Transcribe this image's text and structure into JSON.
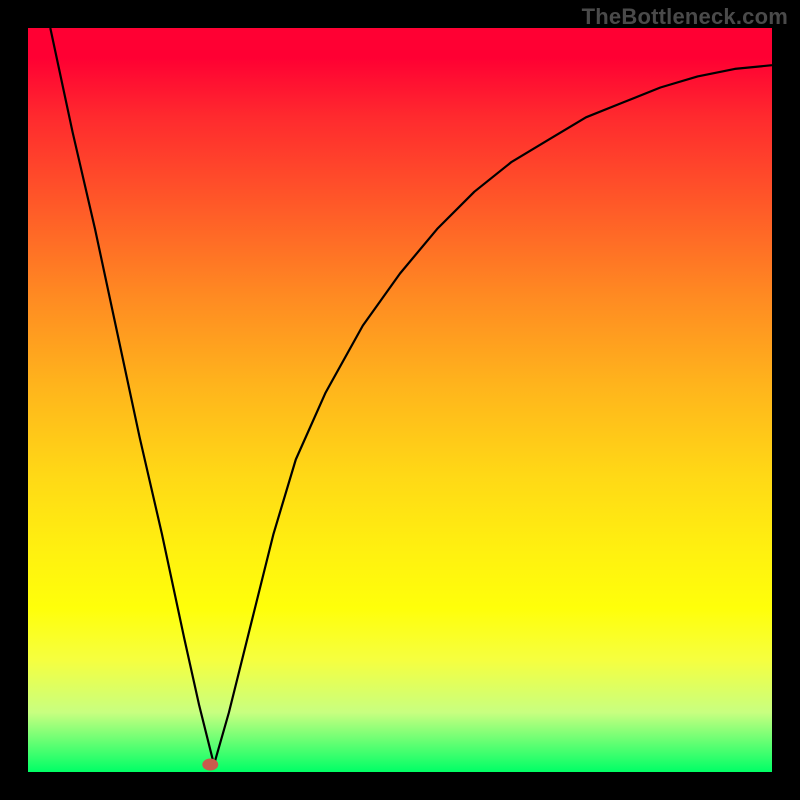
{
  "watermark": "TheBottleneck.com",
  "chart_data": {
    "type": "line",
    "title": "",
    "xlabel": "",
    "ylabel": "",
    "xlim": [
      0,
      100
    ],
    "ylim": [
      0,
      100
    ],
    "grid": false,
    "legend": "none",
    "series": [
      {
        "name": "bottleneck-curve",
        "x": [
          3,
          6,
          9,
          12,
          15,
          18,
          21,
          23,
          25,
          27,
          30,
          33,
          36,
          40,
          45,
          50,
          55,
          60,
          65,
          70,
          75,
          80,
          85,
          90,
          95,
          100
        ],
        "y": [
          100,
          86,
          73,
          59,
          45,
          32,
          18,
          9,
          1,
          8,
          20,
          32,
          42,
          51,
          60,
          67,
          73,
          78,
          82,
          85,
          88,
          90,
          92,
          93.5,
          94.5,
          95
        ]
      }
    ],
    "marker": {
      "name": "selected-point",
      "x": 24.5,
      "y": 1,
      "color": "#c95b4d",
      "rx": 8,
      "ry": 6
    },
    "colors": {
      "top": "#ff0033",
      "bottom": "#00ff66",
      "frame": "#000000"
    }
  }
}
